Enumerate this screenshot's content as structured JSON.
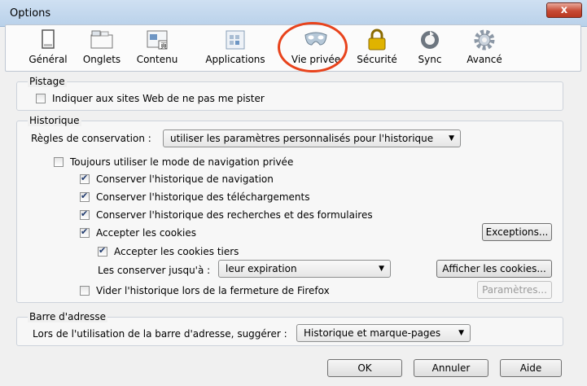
{
  "window": {
    "title": "Options",
    "close_glyph": "x"
  },
  "toolbar": {
    "items": [
      {
        "label": "Général",
        "icon": "general-icon"
      },
      {
        "label": "Onglets",
        "icon": "tabs-icon"
      },
      {
        "label": "Contenu",
        "icon": "content-icon"
      },
      {
        "label": "Applications",
        "icon": "applications-icon"
      },
      {
        "label": "Vie privée",
        "icon": "privacy-mask-icon"
      },
      {
        "label": "Sécurité",
        "icon": "lock-icon"
      },
      {
        "label": "Sync",
        "icon": "sync-icon"
      },
      {
        "label": "Avancé",
        "icon": "gear-icon"
      }
    ],
    "selected": "Vie privée",
    "highlight_color": "#e8431c"
  },
  "tracking": {
    "title": "Pistage",
    "dnt_label": "Indiquer aux sites Web de ne pas me pister",
    "dnt_checked": false
  },
  "history": {
    "title": "Historique",
    "rules_label": "Règles de conservation :",
    "rules_value": "utiliser les paramètres personnalisés pour l'historique",
    "private_label": "Toujours utiliser le mode de navigation privée",
    "private_checked": false,
    "browsing_label": "Conserver l'historique de navigation",
    "downloads_label": "Conserver l'historique des téléchargements",
    "forms_label": "Conserver l'historique des recherches et des formulaires",
    "cookies_label": "Accepter les cookies",
    "exceptions_button": "Exceptions...",
    "third_party_label": "Accepter les cookies tiers",
    "keep_until_label": "Les conserver jusqu'à :",
    "keep_until_value": "leur expiration",
    "show_cookies_button": "Afficher les cookies...",
    "clear_on_close_label": "Vider l'historique lors de la fermeture de Firefox",
    "clear_on_close_checked": false,
    "settings_button": "Paramètres..."
  },
  "address_bar": {
    "title": "Barre d'adresse",
    "suggest_label": "Lors de l'utilisation de la barre d'adresse, suggérer :",
    "suggest_value": "Historique et marque-pages"
  },
  "footer": {
    "ok": "OK",
    "cancel": "Annuler",
    "help": "Aide"
  }
}
